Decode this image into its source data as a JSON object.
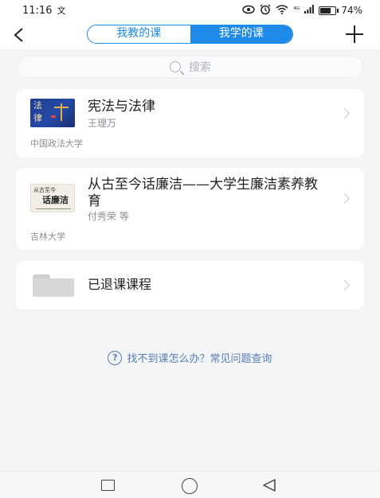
{
  "status_bar": {
    "time": "11:16",
    "notif_glyph": "文",
    "icons": [
      "eye-icon",
      "alarm-icon",
      "wifi-icon",
      "signal-icon"
    ],
    "network": "⁴ᴳ",
    "battery_percent": "74%",
    "battery_level": 0.74
  },
  "header": {
    "back_glyph": "<",
    "tabs": [
      {
        "label": "我教的课",
        "active": false
      },
      {
        "label": "我学的课",
        "active": true
      }
    ],
    "accent_color": "#1f8ae8"
  },
  "search": {
    "placeholder": "搜索"
  },
  "courses": [
    {
      "title": "宪法与法律",
      "teacher": "王理万",
      "school": "中国政法大学",
      "cover_text": "法\n律"
    },
    {
      "title": "从古至今话廉洁——大学生廉洁素养教育",
      "teacher": "付秀荣 等",
      "school": "吉林大学",
      "cover_text_top": "从古至今",
      "cover_text_main": "话廉洁"
    }
  ],
  "dropped": {
    "title": "已退课课程"
  },
  "help": {
    "icon_glyph": "?",
    "text": "找不到课怎么办？常见问题查询"
  },
  "nav_bar": {
    "buttons": [
      "recent-apps-button",
      "home-button",
      "back-nav-button"
    ]
  }
}
